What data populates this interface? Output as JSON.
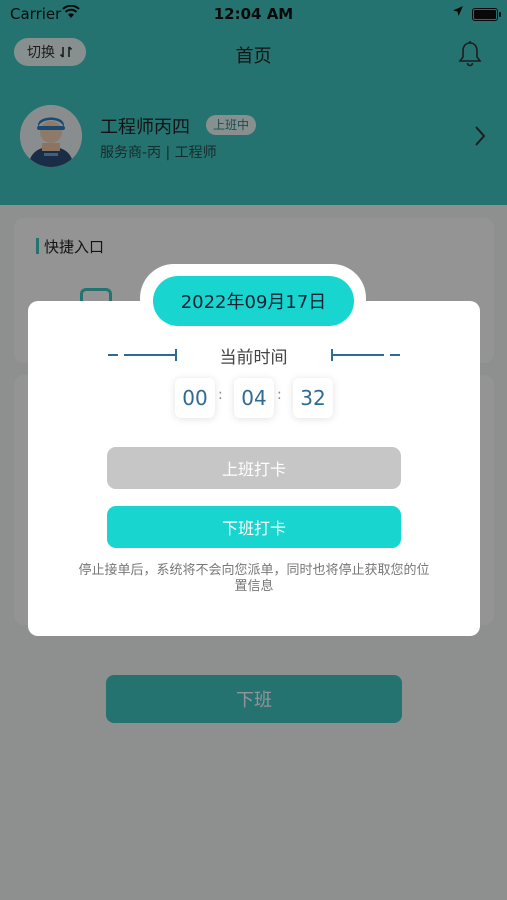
{
  "status_bar": {
    "carrier": "Carrier",
    "time": "12:04 AM"
  },
  "header": {
    "switch_label": "切换",
    "title": "首页"
  },
  "user": {
    "name": "工程师丙四",
    "status_badge": "上班中",
    "subtitle": "服务商-丙 | 工程师"
  },
  "quick_entry": {
    "title": "快捷入口"
  },
  "footer": {
    "offduty_label": "下班"
  },
  "modal": {
    "date": "2022年09月17日",
    "time_label": "当前时间",
    "time": {
      "hours": "00",
      "minutes": "04",
      "seconds": "32",
      "separator": ":"
    },
    "clock_in_label": "上班打卡",
    "clock_out_label": "下班打卡",
    "notice": "停止接单后，系统将不会向您派单，同时也将停止获取您的位置信息"
  },
  "colors": {
    "header_teal": "#40c7c1",
    "accent_cyan": "#18d6cf",
    "disabled_gray": "#c6c6c6",
    "time_digit": "#2f6a95"
  },
  "icons": {
    "wifi": "wifi-icon",
    "location": "location-arrow-icon",
    "battery": "battery-icon",
    "bell": "bell-icon",
    "swap": "swap-icon",
    "chevron": "chevron-right-icon"
  }
}
